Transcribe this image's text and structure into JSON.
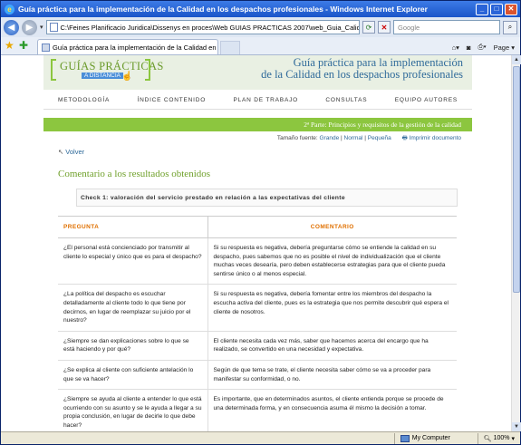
{
  "window": {
    "title": "Guía práctica para la implementación de la Calidad en los despachos profesionales - Windows Internet Explorer"
  },
  "addressbar": {
    "url": "C:\\Feines Planificacio Juridica\\Dissenys en proces\\Web GUIAS PRACTICAS 2007\\web_Guia_Calidad\\calc",
    "search_placeholder": "Google"
  },
  "tabs": {
    "active_label": "Guía práctica para la implementación de la Calidad en l...",
    "page_menu": "Page"
  },
  "site": {
    "logo_word": "GUÍAS PRÁCTICAS",
    "logo_sub": "A DISTANCIA",
    "title_line1": "Guía práctica para la implementación",
    "title_line2": "de la Calidad en los despachos profesionales",
    "nav": [
      "METODOLOGÍA",
      "ÍNDICE CONTENIDO",
      "PLAN DE TRABAJO",
      "CONSULTAS",
      "EQUIPO AUTORES"
    ],
    "green_banner": "2ª Parte: Principios y requisitos de la gestión de la calidad",
    "font_label": "Tamaño fuente:",
    "font_sizes": [
      "Grande",
      "Normal",
      "Pequeña"
    ],
    "print_label": "Imprimir documento",
    "back_label": "Volver",
    "section_title": "Comentario a los resultados obtenidos",
    "check_title": "Check 1: valoración del servicio prestado en relación a las expectativas del cliente"
  },
  "table": {
    "headers": [
      "PREGUNTA",
      "COMENTARIO"
    ],
    "rows": [
      {
        "q": "¿El personal está concienciado por transmitir al cliente lo especial y único que es para el despacho?",
        "c": "Si su respuesta es negativa, debería preguntarse cómo se entiende la calidad en su despacho, pues sabemos que no es posible el nivel de individualización que el cliente muchas veces desearía, pero deben establecerse estrategias para que el cliente pueda sentirse único o al menos especial."
      },
      {
        "q": "¿La política del despacho es escuchar detalladamente al cliente todo lo que tiene por decirnos, en lugar de reemplazar su juicio por el nuestro?",
        "c": "Si su respuesta es negativa, debería fomentar entre los miembros del despacho la escucha activa del cliente, pues es la estrategia que nos permite descubrir qué espera el cliente de nosotros."
      },
      {
        "q": "¿Siempre se dan explicaciones sobre lo que se está haciendo y por qué?",
        "c": "El cliente necesita cada vez más, saber que hacemos acerca del encargo que ha realizado, se convertido en una necesidad y expectativa."
      },
      {
        "q": "¿Se explica al cliente con suficiente antelación lo que se va hacer?",
        "c": "Según de que tema se trate, el cliente necesita saber cómo se va a proceder para manifestar su conformidad, o no."
      },
      {
        "q": "¿Siempre se ayuda al cliente a entender lo que está ocurriendo con su asunto y se le ayuda a llegar a su propia conclusión, en lugar de decirle lo que debe hacer?",
        "c": "Es importante, que en determinados asuntos, el cliente entienda porque se procede de una determinada forma, y en consecuencia asuma él mismo la decisión a tomar."
      }
    ]
  },
  "status": {
    "zone": "My Computer",
    "zoom": "100%"
  }
}
